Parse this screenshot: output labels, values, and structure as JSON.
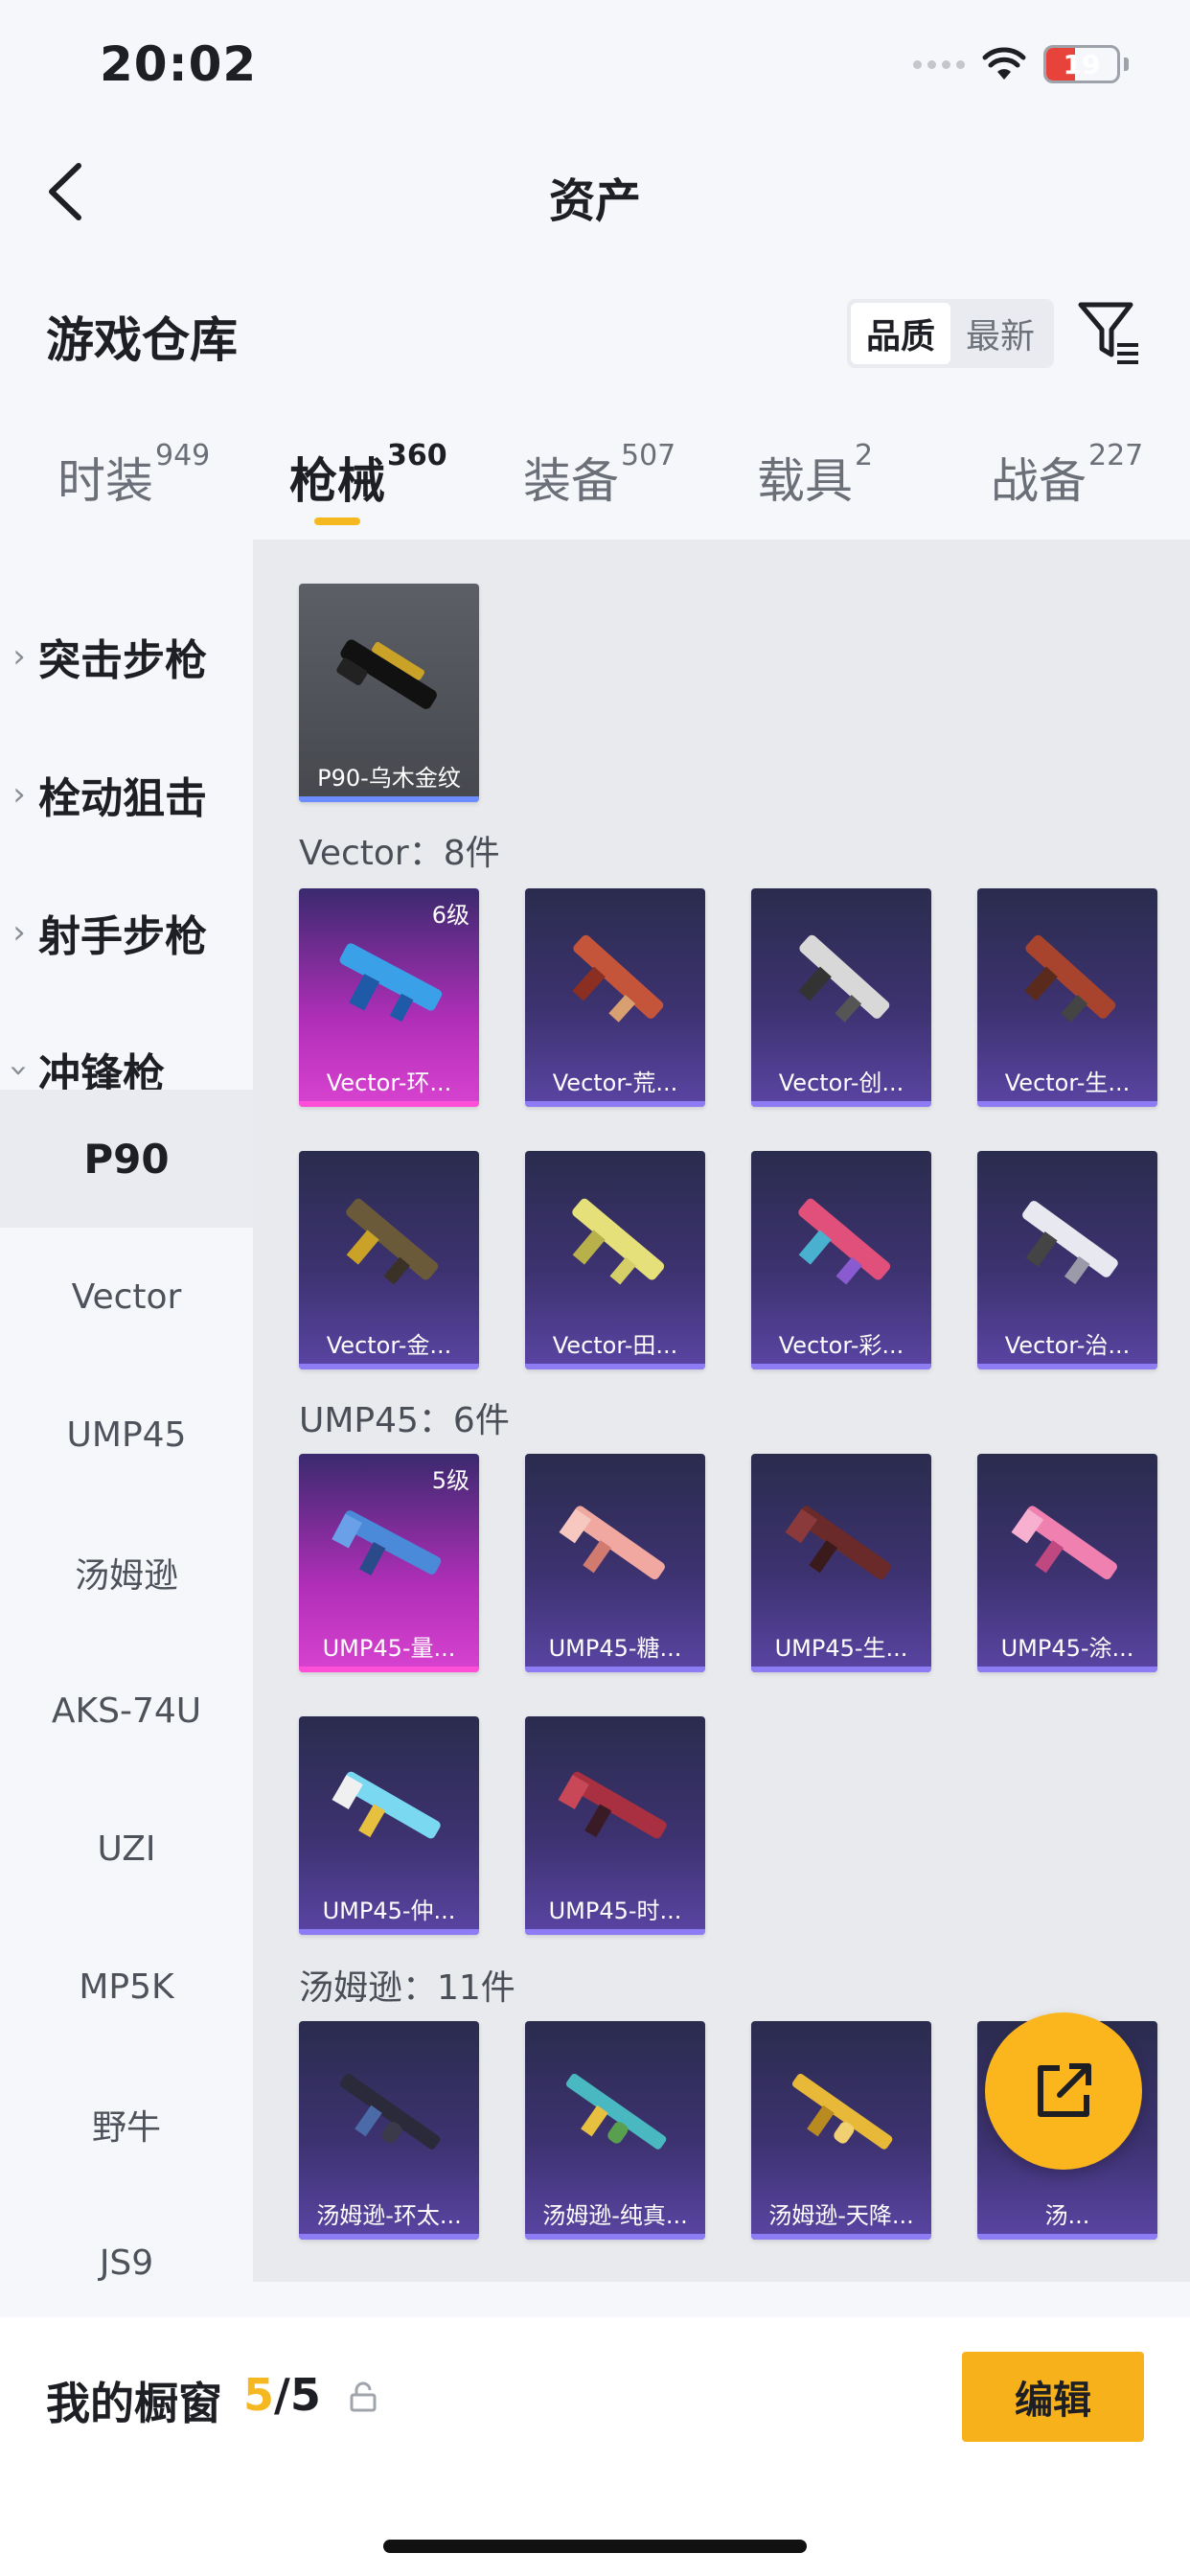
{
  "status": {
    "time": "20:02",
    "battery": "19"
  },
  "nav": {
    "title": "资产"
  },
  "repo": {
    "title": "游戏仓库",
    "sort_quality": "品质",
    "sort_newest": "最新"
  },
  "tabs": [
    {
      "label": "时装",
      "count": "949"
    },
    {
      "label": "枪械",
      "count": "360"
    },
    {
      "label": "装备",
      "count": "507"
    },
    {
      "label": "载具",
      "count": "2"
    },
    {
      "label": "战备",
      "count": "227"
    }
  ],
  "sidebar": {
    "categories": [
      "突击步枪",
      "栓动狙击",
      "射手步枪",
      "冲锋枪"
    ],
    "subitems": [
      "P90",
      "Vector",
      "UMP45",
      "汤姆逊",
      "AKS-74U",
      "UZI",
      "MP5K",
      "野牛",
      "JS9"
    ]
  },
  "content": {
    "p90_items": [
      {
        "name": "P90-乌木金纹"
      }
    ],
    "vector_label": "Vector：8件",
    "vector_items": [
      {
        "name": "Vector-环...",
        "level": "6级"
      },
      {
        "name": "Vector-荒..."
      },
      {
        "name": "Vector-创..."
      },
      {
        "name": "Vector-生..."
      },
      {
        "name": "Vector-金..."
      },
      {
        "name": "Vector-田..."
      },
      {
        "name": "Vector-彩..."
      },
      {
        "name": "Vector-治..."
      }
    ],
    "ump_label": "UMP45：6件",
    "ump_items": [
      {
        "name": "UMP45-量...",
        "level": "5级"
      },
      {
        "name": "UMP45-糖..."
      },
      {
        "name": "UMP45-生..."
      },
      {
        "name": "UMP45-涂..."
      },
      {
        "name": "UMP45-仲..."
      },
      {
        "name": "UMP45-时..."
      }
    ],
    "thompson_label": "汤姆逊：11件",
    "thompson_items": [
      {
        "name": "汤姆逊-环太..."
      },
      {
        "name": "汤姆逊-纯真..."
      },
      {
        "name": "汤姆逊-天降..."
      },
      {
        "name": "汤..."
      }
    ]
  },
  "footer": {
    "title": "我的橱窗",
    "count_current": "5",
    "count_total": "/5",
    "edit": "编辑"
  }
}
